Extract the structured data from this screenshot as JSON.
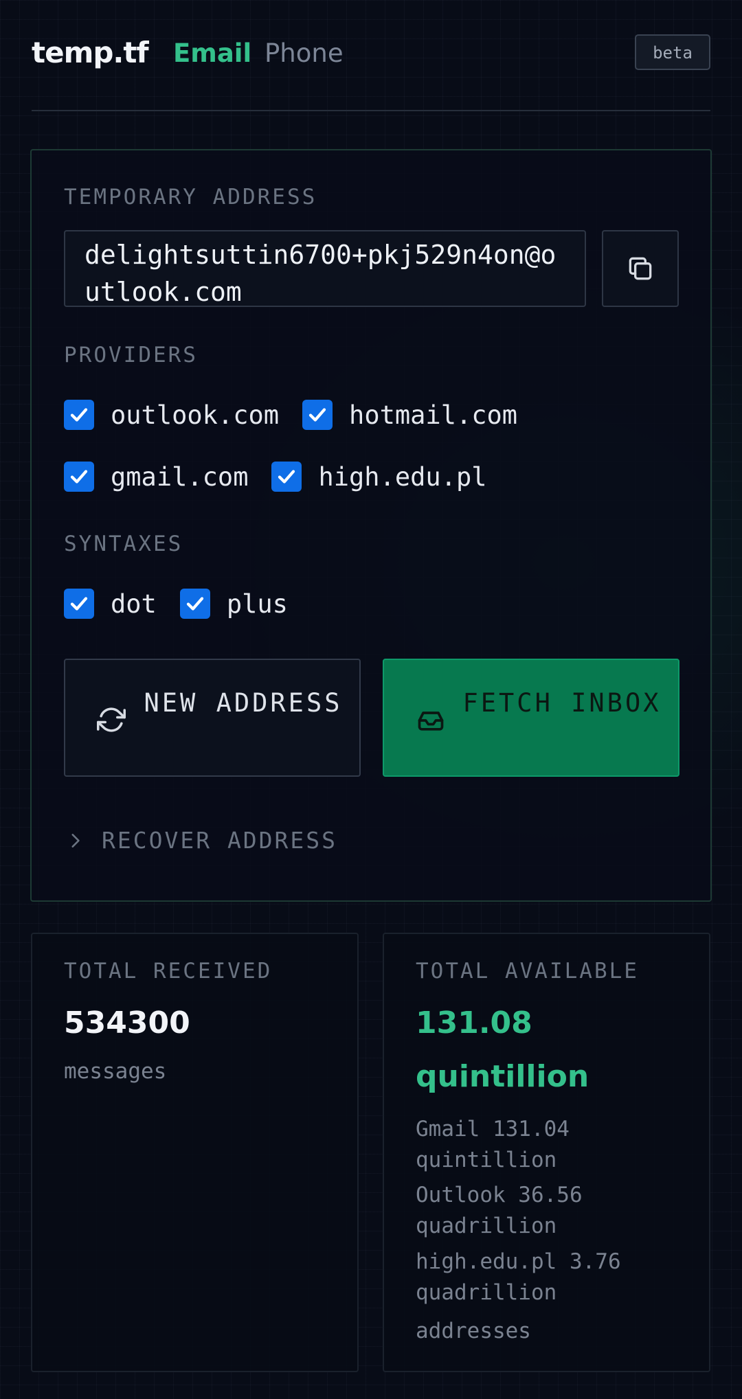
{
  "app": {
    "logo": "temp.tf",
    "badge": "beta"
  },
  "nav": {
    "tabs": [
      {
        "label": "Email",
        "active": true
      },
      {
        "label": "Phone",
        "active": false
      }
    ]
  },
  "address_card": {
    "title": "TEMPORARY ADDRESS",
    "address": "delightsuttin6700+pkj529n4on@outlook.com",
    "copy_icon": "copy-icon",
    "providers_label": "PROVIDERS",
    "providers": [
      {
        "label": "outlook.com",
        "checked": true
      },
      {
        "label": "hotmail.com",
        "checked": true
      },
      {
        "label": "gmail.com",
        "checked": true
      },
      {
        "label": "high.edu.pl",
        "checked": true
      }
    ],
    "syntaxes_label": "SYNTAXES",
    "syntaxes": [
      {
        "label": "dot",
        "checked": true
      },
      {
        "label": "plus",
        "checked": true
      }
    ],
    "new_address_label": "NEW ADDRESS",
    "fetch_inbox_label": "FETCH INBOX",
    "recover_label": "RECOVER ADDRESS"
  },
  "stats": {
    "received": {
      "label": "TOTAL RECEIVED",
      "value": "534300",
      "unit": "messages"
    },
    "available": {
      "label": "TOTAL AVAILABLE",
      "value_line1": "131.08",
      "value_line2": "quintillion",
      "breakdown": [
        {
          "line1": "Gmail 131.04",
          "line2": "quintillion"
        },
        {
          "line1": "Outlook 36.56",
          "line2": "quadrillion"
        },
        {
          "line1": "high.edu.pl 3.76",
          "line2": "quadrillion"
        }
      ],
      "unit": "addresses"
    }
  },
  "colors": {
    "accent": "#34c08b",
    "fetch_bg": "#07794f",
    "checkbox": "#0f6ee7",
    "background": "#080c17"
  }
}
